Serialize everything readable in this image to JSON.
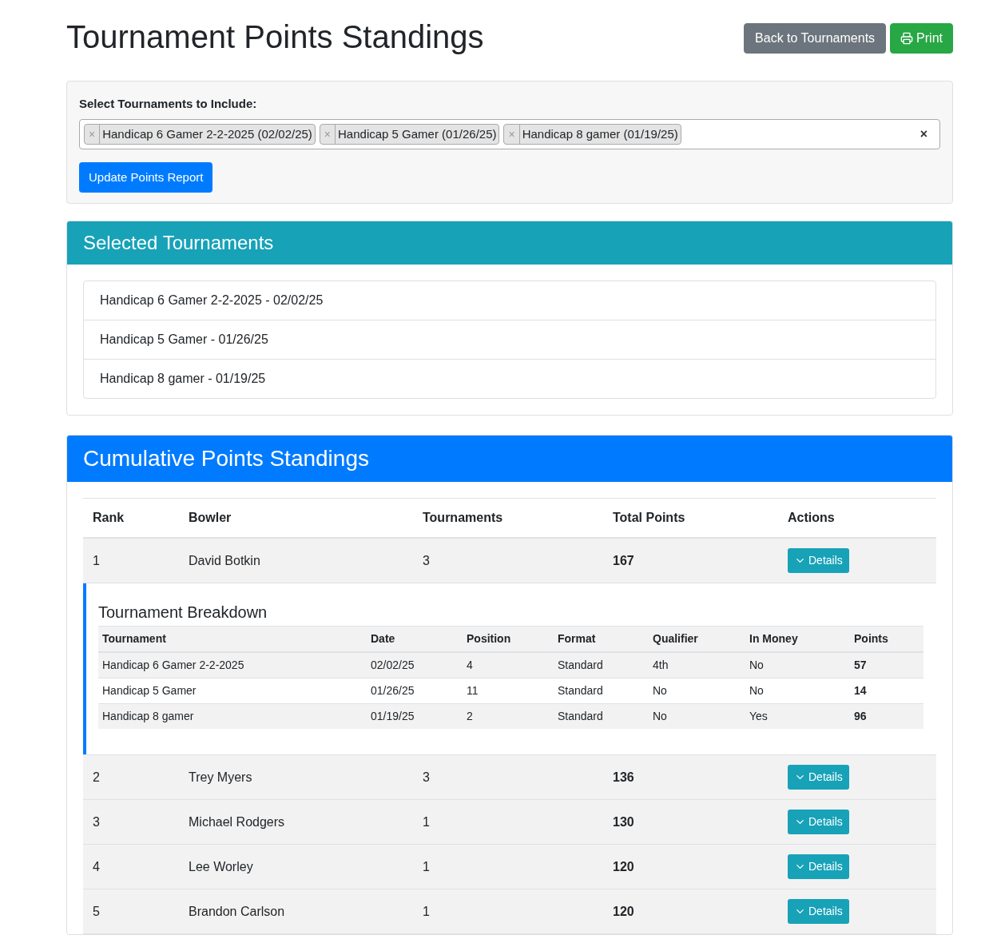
{
  "page": {
    "title": "Tournament Points Standings",
    "buttons": [
      {
        "label": "Back to Tournaments",
        "kind": "secondary"
      },
      {
        "label": "Print",
        "kind": "print"
      }
    ]
  },
  "filter": {
    "label": "Select Tournaments to Include:",
    "tags": [
      {
        "remove": "×",
        "label": "Handicap 6 Gamer 2-2-2025 (02/02/25)"
      },
      {
        "remove": "×",
        "label": "Handicap 5 Gamer (01/26/25)"
      },
      {
        "remove": "×",
        "label": "Handicap 8 gamer (01/19/25)"
      }
    ],
    "clear": "×",
    "submit": "Update Points Report"
  },
  "selected_tournaments": {
    "title": "Selected Tournaments",
    "items": [
      "Handicap 6 Gamer 2-2-2025 - 02/02/25",
      "Handicap 5 Gamer - 01/26/25",
      "Handicap 8 gamer - 01/19/25"
    ]
  },
  "standings": {
    "title": "Cumulative Points Standings",
    "columns": [
      "Rank",
      "Bowler",
      "Tournaments",
      "Total Points",
      "Actions"
    ],
    "rows": [
      {
        "rank": "1",
        "bowler": "David Botkin",
        "tournaments": "3",
        "total_points": "167",
        "action": "Details",
        "breakdown": {
          "title": "Tournament Breakdown",
          "columns": [
            "Tournament",
            "Date",
            "Position",
            "Format",
            "Qualifier",
            "In Money",
            "Points"
          ],
          "rows": [
            [
              "Handicap 6 Gamer 2-2-2025",
              "02/02/25",
              "4",
              "Standard",
              "4th",
              "No",
              "57"
            ],
            [
              "Handicap 5 Gamer",
              "01/26/25",
              "11",
              "Standard",
              "No",
              "No",
              "14"
            ],
            [
              "Handicap 8 gamer",
              "01/19/25",
              "2",
              "Standard",
              "No",
              "Yes",
              "96"
            ]
          ]
        }
      },
      {
        "rank": "2",
        "bowler": "Trey Myers",
        "tournaments": "3",
        "total_points": "136",
        "action": "Details"
      },
      {
        "rank": "3",
        "bowler": "Michael Rodgers",
        "tournaments": "1",
        "total_points": "130",
        "action": "Details"
      },
      {
        "rank": "4",
        "bowler": "Lee Worley",
        "tournaments": "1",
        "total_points": "120",
        "action": "Details"
      },
      {
        "rank": "5",
        "bowler": "Brandon Carlson",
        "tournaments": "1",
        "total_points": "120",
        "action": "Details"
      }
    ]
  }
}
